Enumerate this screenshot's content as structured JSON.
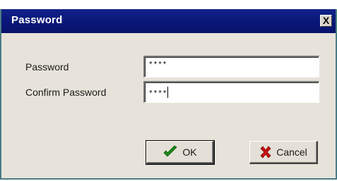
{
  "dialog": {
    "title": "Password",
    "close_label": "X"
  },
  "form": {
    "password_label": "Password",
    "password_value": "****",
    "confirm_label": "Confirm Password",
    "confirm_value": "****"
  },
  "buttons": {
    "ok_label": "OK",
    "ok_icon": "checkmark-icon",
    "cancel_label": "Cancel",
    "cancel_icon": "red-x-icon"
  },
  "colors": {
    "titlebar": "#0a1677",
    "dialog_bg": "#e7e3da",
    "check_green": "#1e8a14",
    "cancel_red": "#cc1010"
  }
}
